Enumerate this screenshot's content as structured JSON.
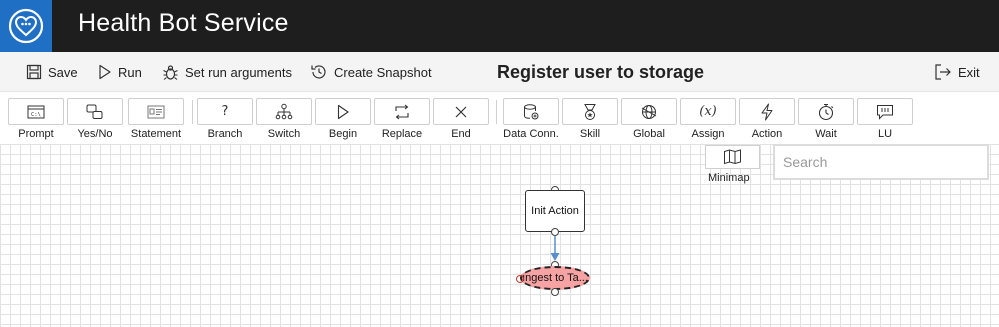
{
  "header": {
    "app_title": "Health Bot Service",
    "logo_icon": "heart-chat-icon"
  },
  "commandbar": {
    "save": "Save",
    "run": "Run",
    "set_run_arguments": "Set run arguments",
    "create_snapshot": "Create Snapshot",
    "page_title": "Register user to storage",
    "exit": "Exit"
  },
  "toolbox": {
    "items": [
      {
        "label": "Prompt",
        "icon": "prompt-icon"
      },
      {
        "label": "Yes/No",
        "icon": "yes-no-icon"
      },
      {
        "label": "Statement",
        "icon": "statement-icon"
      },
      {
        "label": "Branch",
        "icon": "branch-icon"
      },
      {
        "label": "Switch",
        "icon": "switch-icon"
      },
      {
        "label": "Begin",
        "icon": "begin-icon"
      },
      {
        "label": "Replace",
        "icon": "replace-icon"
      },
      {
        "label": "End",
        "icon": "end-icon"
      },
      {
        "label": "Data Conn.",
        "icon": "data-connection-icon"
      },
      {
        "label": "Skill",
        "icon": "skill-icon"
      },
      {
        "label": "Global",
        "icon": "global-icon"
      },
      {
        "label": "Assign",
        "icon": "assign-icon"
      },
      {
        "label": "Action",
        "icon": "action-icon"
      },
      {
        "label": "Wait",
        "icon": "wait-icon"
      },
      {
        "label": "LU",
        "icon": "lu-icon"
      }
    ]
  },
  "canvas": {
    "minimap_label": "Minimap",
    "search_placeholder": "Search",
    "nodes": {
      "init_action": "Init Action",
      "ingest": "Ingest to Ta..."
    },
    "colors": {
      "ingest_fill": "#f7a3a3",
      "connector": "#5b8fc9"
    }
  }
}
